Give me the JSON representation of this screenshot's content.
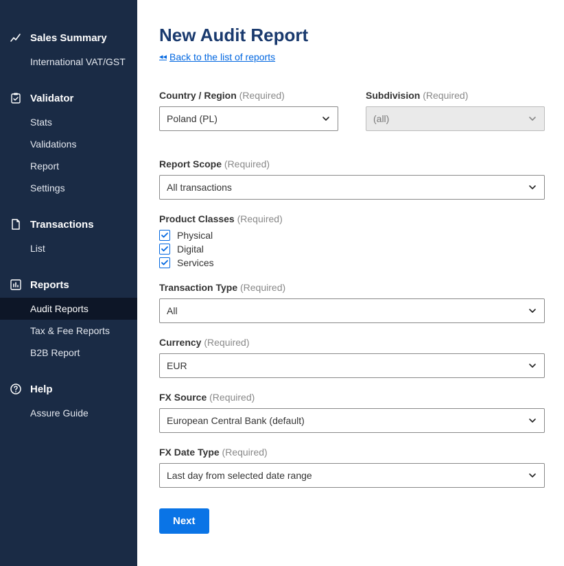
{
  "sidebar": {
    "groups": [
      {
        "icon": "chart-line",
        "label": "Sales Summary",
        "items": [
          {
            "label": "International VAT/GST",
            "active": false
          }
        ]
      },
      {
        "icon": "clipboard-check",
        "label": "Validator",
        "items": [
          {
            "label": "Stats",
            "active": false
          },
          {
            "label": "Validations",
            "active": false
          },
          {
            "label": "Report",
            "active": false
          },
          {
            "label": "Settings",
            "active": false
          }
        ]
      },
      {
        "icon": "document",
        "label": "Transactions",
        "items": [
          {
            "label": "List",
            "active": false
          }
        ]
      },
      {
        "icon": "bar-chart",
        "label": "Reports",
        "items": [
          {
            "label": "Audit Reports",
            "active": true
          },
          {
            "label": "Tax & Fee Reports",
            "active": false
          },
          {
            "label": "B2B Report",
            "active": false
          }
        ]
      },
      {
        "icon": "help-circle",
        "label": "Help",
        "items": [
          {
            "label": "Assure Guide",
            "active": false
          }
        ]
      }
    ]
  },
  "page": {
    "title": "New Audit Report",
    "back_label": "Back to the list of reports"
  },
  "form": {
    "required_hint": "(Required)",
    "country": {
      "label": "Country / Region",
      "value": "Poland (PL)"
    },
    "subdivision": {
      "label": "Subdivision",
      "value": "(all)"
    },
    "scope": {
      "label": "Report Scope",
      "value": "All transactions"
    },
    "product_classes": {
      "label": "Product Classes",
      "options": [
        "Physical",
        "Digital",
        "Services"
      ]
    },
    "txn_type": {
      "label": "Transaction Type",
      "value": "All"
    },
    "currency": {
      "label": "Currency",
      "value": "EUR"
    },
    "fx_source": {
      "label": "FX Source",
      "value": "European Central Bank (default)"
    },
    "fx_date_type": {
      "label": "FX Date Type",
      "value": "Last day from selected date range"
    },
    "next_label": "Next"
  }
}
